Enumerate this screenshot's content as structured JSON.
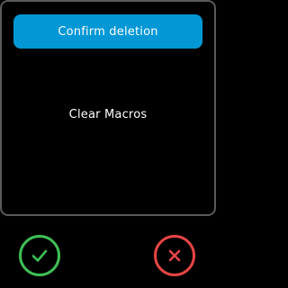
{
  "dialog": {
    "title": "Confirm deletion",
    "message": "Clear Macros"
  },
  "actions": {
    "confirm_icon": "checkmark-icon",
    "cancel_icon": "close-icon"
  },
  "colors": {
    "title_bar": "#0397d6",
    "confirm": "#3fbf55",
    "cancel": "#e84545",
    "dialog_border": "#5a5a5a",
    "background": "#000000",
    "text": "#ffffff"
  }
}
